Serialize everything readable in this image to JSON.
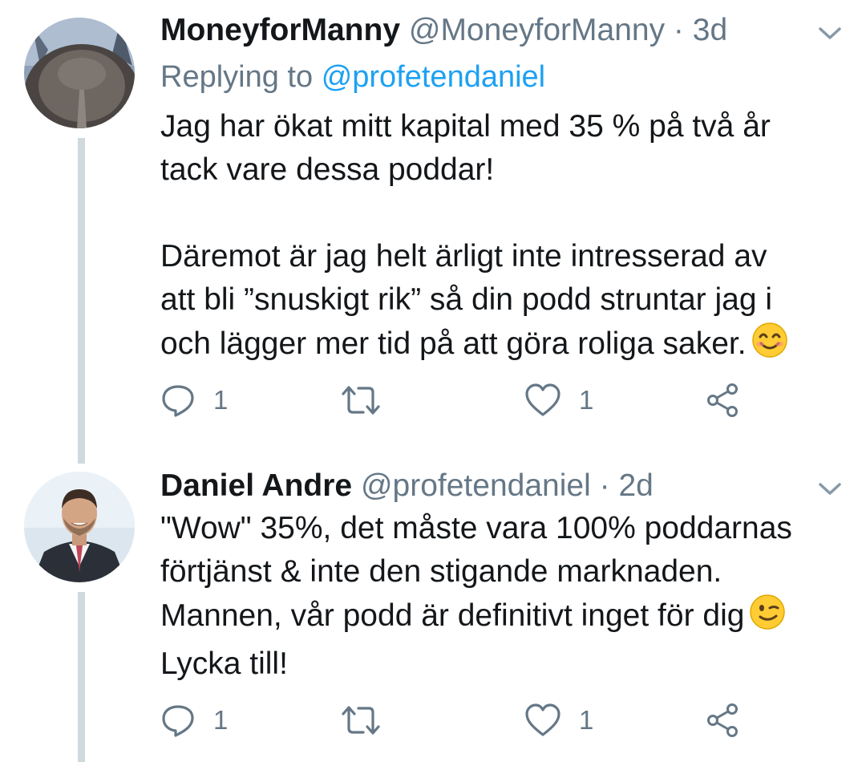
{
  "tweets": [
    {
      "author": {
        "name": "MoneyforManny",
        "handle": "@MoneyforManny"
      },
      "separator": "·",
      "time": "3d",
      "reply_prefix": "Replying to",
      "reply_mention": "@profetendaniel",
      "body_lines": [
        "Jag har ökat mitt kapital med 35 % på två år",
        "tack vare dessa poddar!",
        "",
        "Däremot är jag helt ärligt inte intresserad av",
        "att bli ”snuskigt rik” så din podd struntar jag i",
        "och lägger mer tid på att göra roliga saker."
      ],
      "emoji": "smiling-face-icon",
      "reply_count": "1",
      "retweet_count": "",
      "like_count": "1"
    },
    {
      "author": {
        "name": "Daniel Andre",
        "handle": "@profetendaniel"
      },
      "separator": "·",
      "time": "2d",
      "body_lines": [
        "\"Wow\" 35%, det måste vara 100% poddarnas",
        "förtjänst & inte den stigande marknaden.",
        "Mannen, vår podd är definitivt inget för dig",
        "Lycka till!"
      ],
      "emoji": "winking-face-icon",
      "reply_count": "1",
      "retweet_count": "",
      "like_count": "1"
    }
  ],
  "icons": [
    "reply-icon",
    "retweet-icon",
    "like-icon",
    "share-icon",
    "chevron-down-icon"
  ],
  "colors": {
    "text": "#14171a",
    "secondary": "#657786",
    "link": "#1da1f2",
    "thread_line": "#cfd9de"
  }
}
